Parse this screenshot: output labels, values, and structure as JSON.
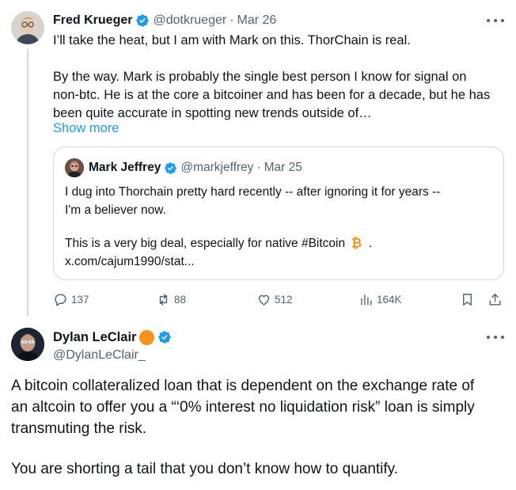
{
  "tweet1": {
    "author_name": "Fred Krueger",
    "handle": "@dotkrueger",
    "separator": "·",
    "date": "Mar 26",
    "text_line1": "I’ll take the heat, but I am with Mark on this. ThorChain is real.",
    "text_para2_line1": "By the way. Mark is probably the single best person I know for signal on",
    "text_para2_line2": "non-btc. He is at the core a bitcoiner and has been for a decade, but he has",
    "text_para2_line3": "been quite accurate in spotting new trends outside of…",
    "show_more": "Show more",
    "quote": {
      "author_name": "Mark Jeffrey",
      "handle": "@markjeffrey",
      "separator": "·",
      "date": "Mar 25",
      "line1": "I dug into Thorchain pretty hard recently -- after ignoring it for years --",
      "line2": "I'm a believer now.",
      "line3_text": "This is a very big deal, especially for native #Bitcoin",
      "line3_end": ".",
      "line4": "x.com/cajum1990/stat..."
    },
    "actions": {
      "replies": "137",
      "reposts": "88",
      "likes": "512",
      "views": "164K"
    }
  },
  "tweet2": {
    "author_name": "Dylan LeClair",
    "handle": "@DylanLeClair_",
    "text_line1": "A bitcoin collateralized loan that is dependent on the exchange rate of",
    "text_line2": "an altcoin to offer you a “‘0% interest no liquidation risk” loan is simply",
    "text_line3": "transmuting the risk.",
    "text_para2": "You are shorting a tail that you don’t know how to quantify."
  },
  "colors": {
    "text": "#0f1419",
    "secondary": "#536471",
    "link": "#1d9bf0",
    "verified": "#1d9bf0",
    "border": "#cfd9de",
    "bitcoin_orange": "#f7931a"
  },
  "icons": [
    "verified-badge-icon",
    "more-icon",
    "reply-icon",
    "repost-icon",
    "like-icon",
    "views-icon",
    "bookmark-icon",
    "share-icon",
    "bitcoin-emoji-icon"
  ]
}
